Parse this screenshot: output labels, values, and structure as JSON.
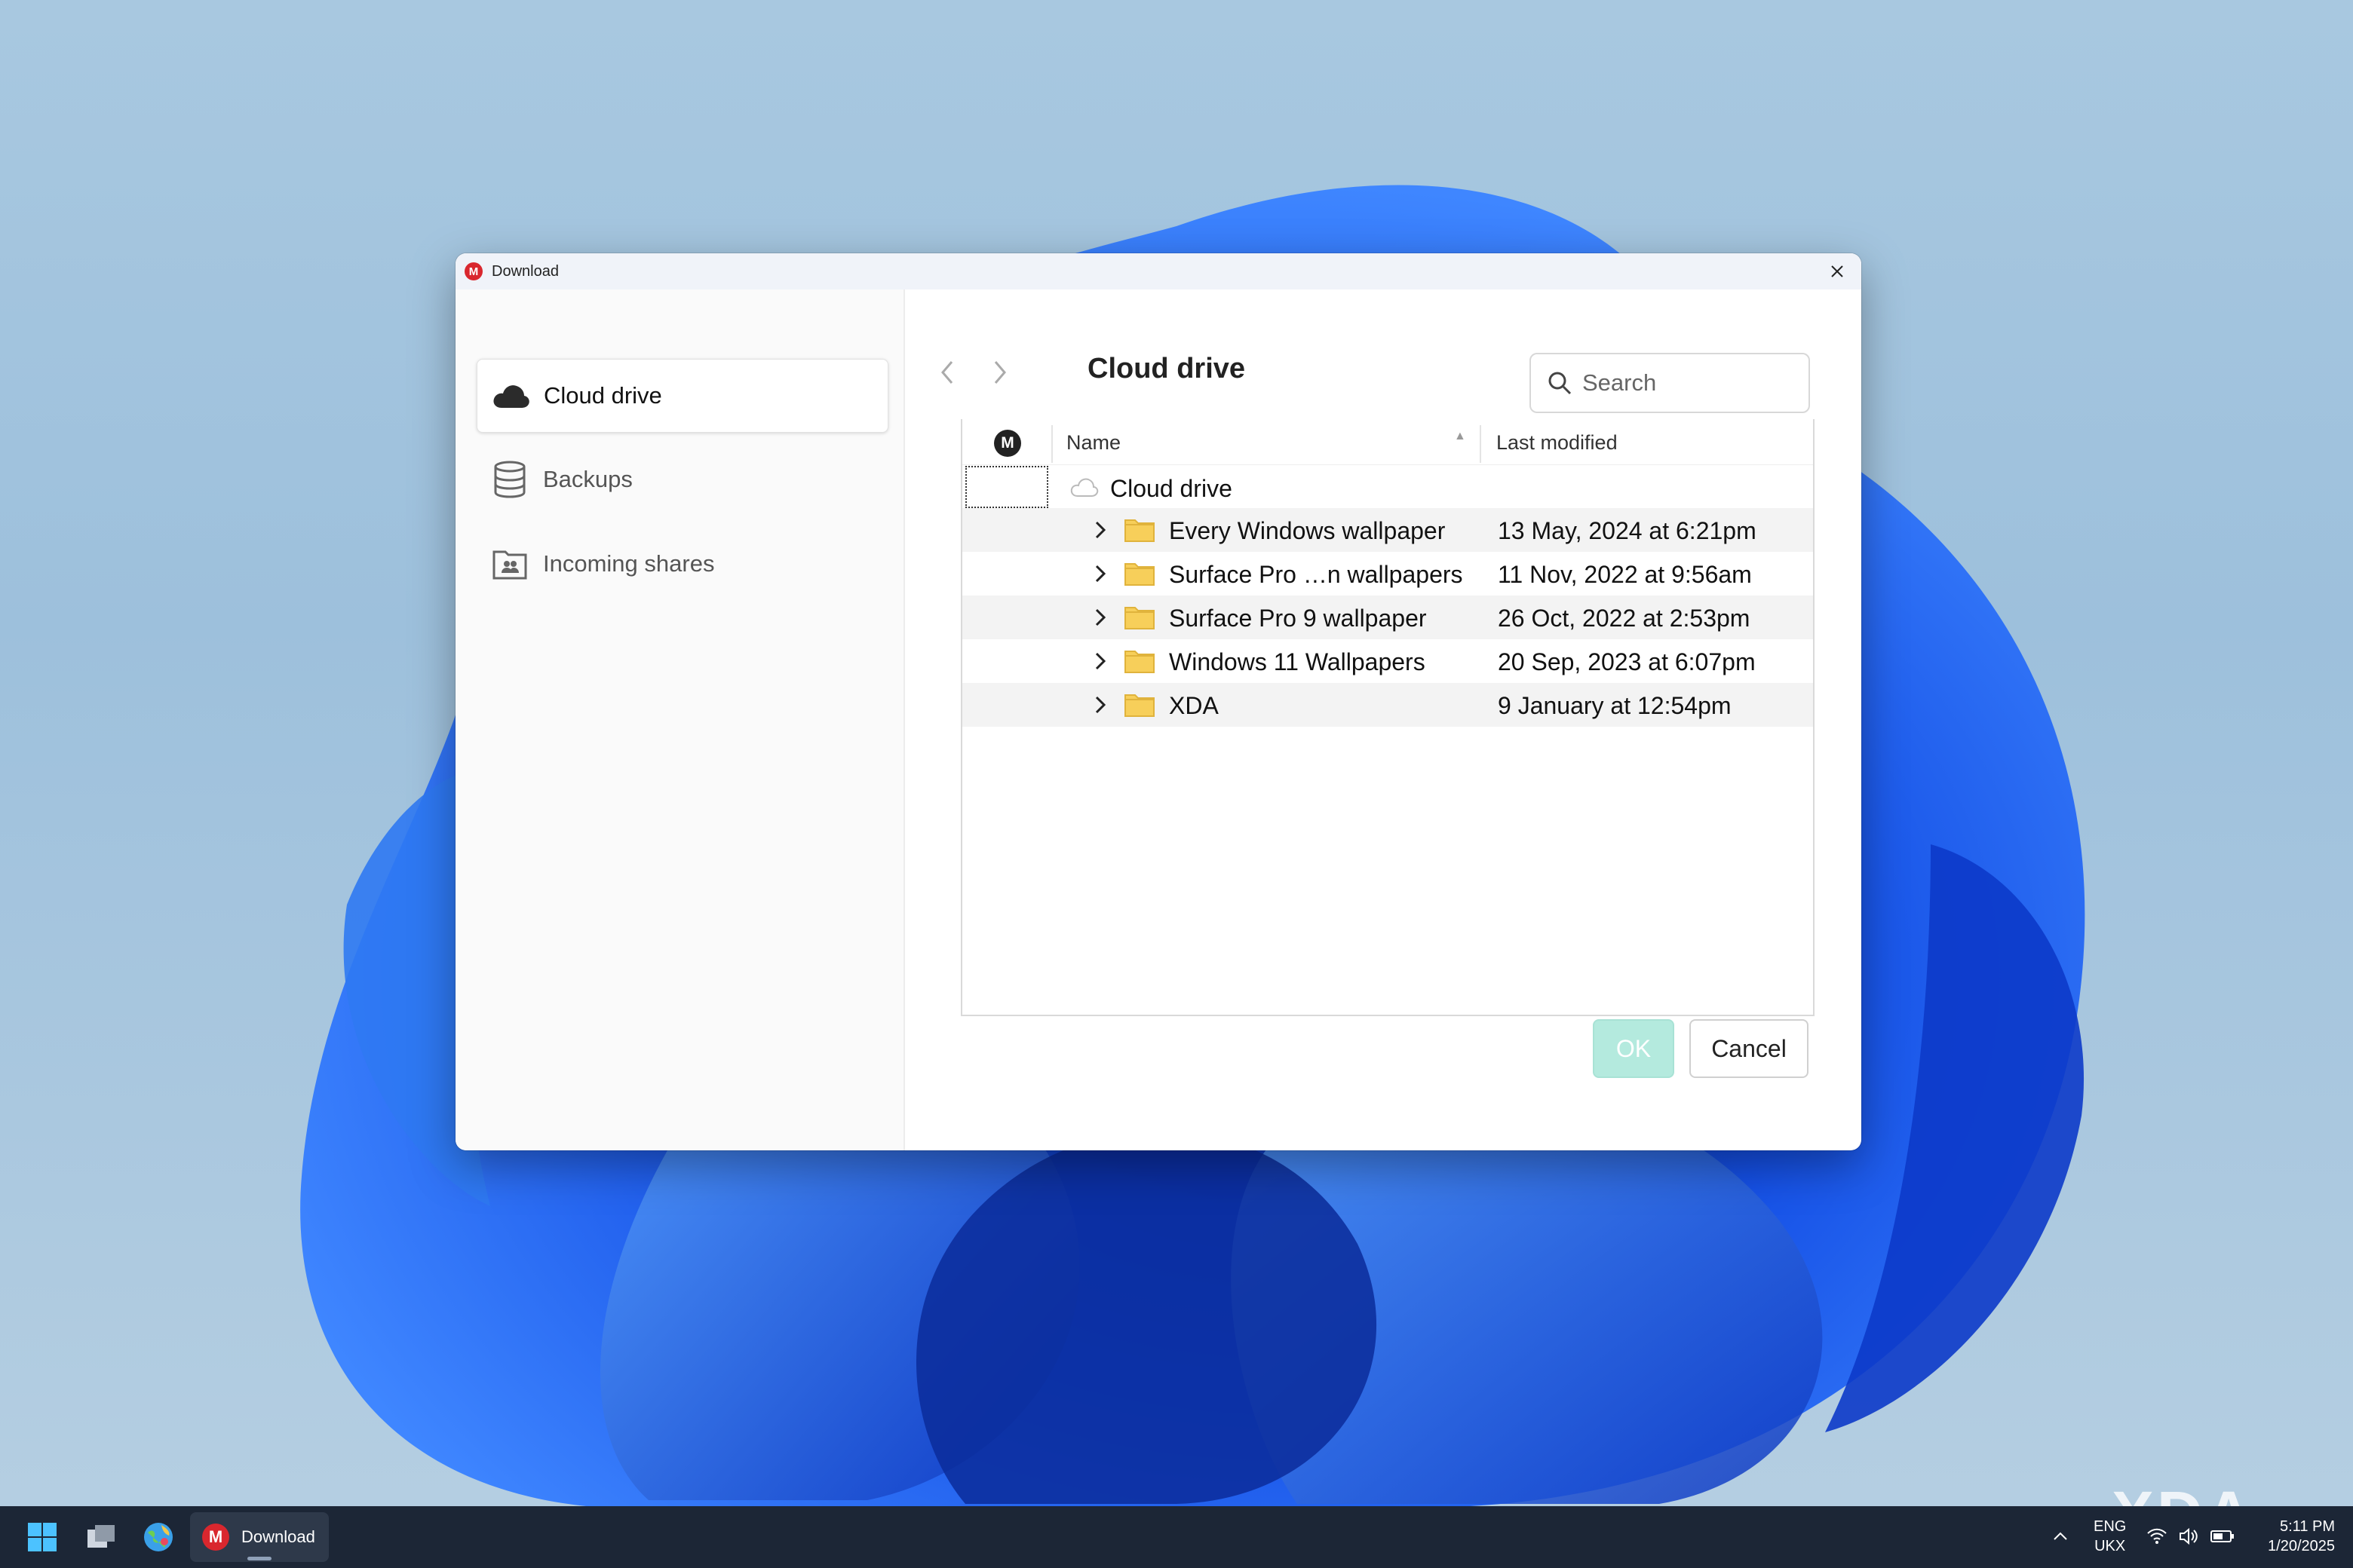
{
  "window": {
    "title": "Download",
    "app_logo_letter": "M"
  },
  "sidebar": {
    "items": [
      {
        "label": "Cloud drive",
        "icon": "cloud-icon",
        "active": true
      },
      {
        "label": "Backups",
        "icon": "database-icon",
        "active": false
      },
      {
        "label": "Incoming shares",
        "icon": "shared-folder-icon",
        "active": false
      }
    ]
  },
  "header": {
    "breadcrumb": "Cloud drive"
  },
  "search": {
    "placeholder": "Search"
  },
  "tree": {
    "columns": {
      "name": "Name",
      "last_modified": "Last modified"
    },
    "root_label": "Cloud drive",
    "rows": [
      {
        "name": "Every Windows wallpaper",
        "modified": "13 May, 2024 at 6:21pm"
      },
      {
        "name": "Surface Pro …n wallpapers",
        "modified": "11 Nov, 2022 at 9:56am"
      },
      {
        "name": "Surface Pro 9 wallpaper",
        "modified": "26 Oct, 2022 at 2:53pm"
      },
      {
        "name": "Windows 11 Wallpapers",
        "modified": "20 Sep, 2023 at 6:07pm"
      },
      {
        "name": "XDA",
        "modified": "9 January at 12:54pm"
      }
    ]
  },
  "buttons": {
    "ok": "OK",
    "cancel": "Cancel"
  },
  "taskbar": {
    "app_label": "Download",
    "lang_line1": "ENG",
    "lang_line2": "UKX",
    "time": "5:11 PM",
    "date": "1/20/2025"
  },
  "watermark": "XDA",
  "colors": {
    "mega_red": "#d9272e",
    "ok_disabled": "#b4eade",
    "folder_yellow": "#f7cf5a",
    "taskbar": "#1c2636"
  }
}
